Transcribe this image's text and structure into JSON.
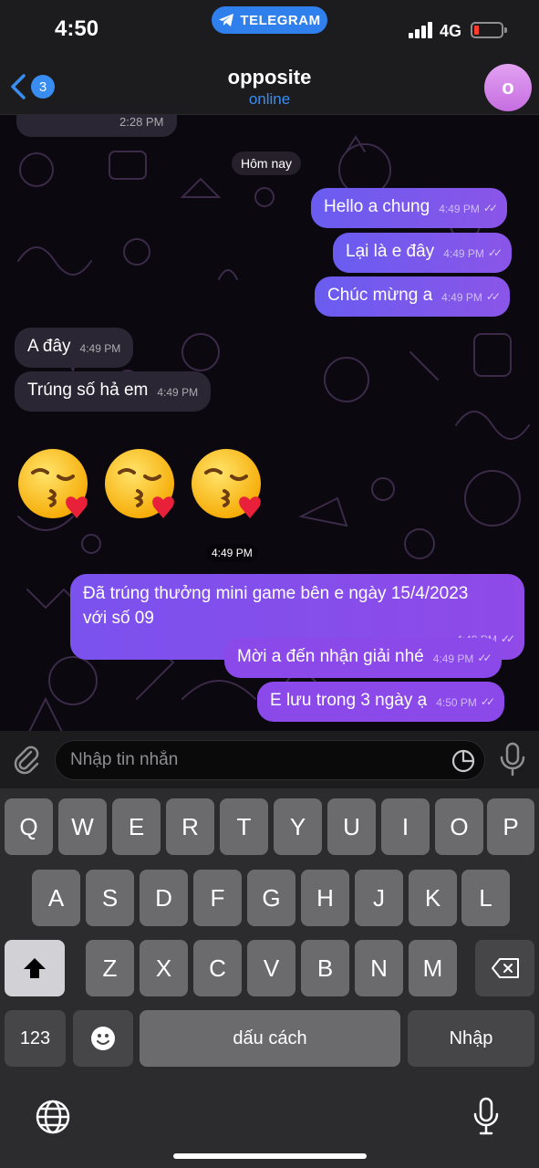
{
  "status_bar": {
    "time": "4:50",
    "pill_label": "TELEGRAM",
    "network": "4G",
    "battery_level": 0.12
  },
  "header": {
    "back_badge": "3",
    "title": "opposite",
    "subtitle": "online",
    "avatar_letter": "o"
  },
  "chat": {
    "previous_timestamp": "2:28 PM",
    "date_separator": "Hôm nay",
    "messages": [
      {
        "text": "Hello a chung",
        "time": "4:49 PM",
        "dir": "out"
      },
      {
        "text": "Lại là e đây",
        "time": "4:49 PM",
        "dir": "out"
      },
      {
        "text": "Chúc mừng a",
        "time": "4:49 PM",
        "dir": "out"
      },
      {
        "text": "A đây",
        "time": "4:49 PM",
        "dir": "in"
      },
      {
        "text": "Trúng số hả em",
        "time": "4:49 PM",
        "dir": "in"
      },
      {
        "text_line1": "Đã trúng thưởng mini game bên e ngày 15/4/2023",
        "text_line2": "với số 09",
        "time": "4:49 PM",
        "dir": "out"
      },
      {
        "text": "Mời a đến nhận giải nhé",
        "time": "4:49 PM",
        "dir": "out"
      },
      {
        "text": "E lưu trong 3 ngày ạ",
        "time": "4:50 PM",
        "dir": "out"
      }
    ],
    "emoji_message": {
      "emoji": [
        "face-blowing-a-kiss",
        "face-blowing-a-kiss",
        "face-blowing-a-kiss"
      ],
      "time": "4:49 PM"
    }
  },
  "composer": {
    "placeholder": "Nhập tin nhắn"
  },
  "keyboard": {
    "row1": [
      "Q",
      "W",
      "E",
      "R",
      "T",
      "Y",
      "U",
      "I",
      "O",
      "P"
    ],
    "row2": [
      "A",
      "S",
      "D",
      "F",
      "G",
      "H",
      "J",
      "K",
      "L"
    ],
    "row3": [
      "Z",
      "X",
      "C",
      "V",
      "B",
      "N",
      "M"
    ],
    "numbers_key": "123",
    "space_key": "dấu cách",
    "return_key": "Nhập"
  },
  "colors": {
    "accent": "#3a8df0",
    "outgoing_bubble": "#6a5cf0",
    "incoming_bubble": "#2b2633",
    "avatar": "#d58ae8"
  }
}
